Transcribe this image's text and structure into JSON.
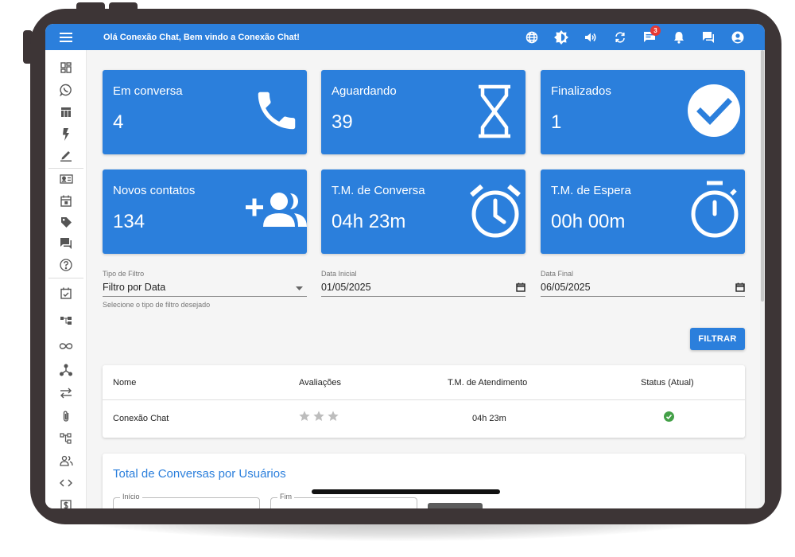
{
  "header": {
    "welcome": "Olá Conexão Chat, Bem vindo a Conexão Chat!",
    "notification_count": "3"
  },
  "cards": [
    {
      "title": "Em conversa",
      "value": "4",
      "icon": "phone-icon"
    },
    {
      "title": "Aguardando",
      "value": "39",
      "icon": "hourglass-icon"
    },
    {
      "title": "Finalizados",
      "value": "1",
      "icon": "check-circle-icon"
    },
    {
      "title": "Novos contatos",
      "value": "134",
      "icon": "add-users-icon"
    },
    {
      "title": "T.M. de Conversa",
      "value": "04h 23m",
      "icon": "alarm-icon"
    },
    {
      "title": "T.M. de Espera",
      "value": "00h 00m",
      "icon": "timer-icon"
    }
  ],
  "filters": {
    "filter_type": {
      "label": "Tipo de Filtro",
      "value": "Filtro por Data",
      "hint": "Selecione o tipo de filtro desejado"
    },
    "start_date": {
      "label": "Data Inicial",
      "value": "01/05/2025"
    },
    "end_date": {
      "label": "Data Final",
      "value": "06/05/2025"
    },
    "button": "FILTRAR"
  },
  "table": {
    "headers": [
      "Nome",
      "Avaliações",
      "T.M. de Atendimento",
      "Status (Atual)"
    ],
    "rows": [
      {
        "name": "Conexão Chat",
        "rating": 0,
        "rating_max": 3,
        "time": "04h 23m",
        "status": "online"
      }
    ]
  },
  "section": {
    "title": "Total de Conversas por Usuários",
    "start_label": "Início",
    "end_label": "Fim"
  },
  "colors": {
    "primary": "#2b7fdc",
    "status_online": "#43a047",
    "star_empty": "#bdbdbd"
  }
}
